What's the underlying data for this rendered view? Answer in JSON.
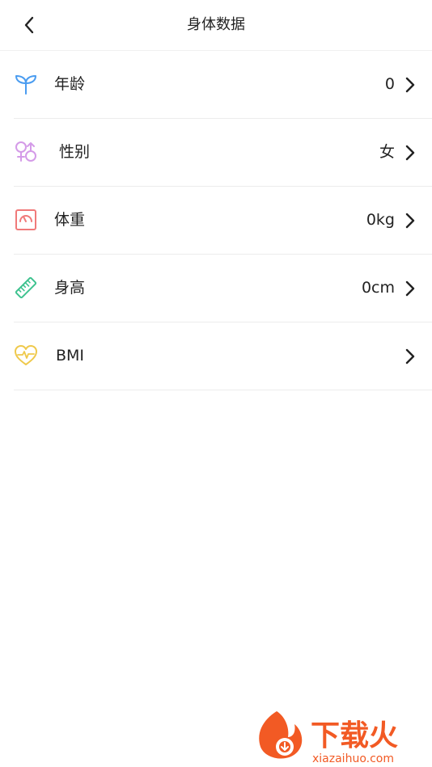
{
  "header": {
    "title": "身体数据"
  },
  "rows": [
    {
      "label": "年龄",
      "value": "0",
      "icon": "sprout-icon"
    },
    {
      "label": "性别",
      "value": "女",
      "icon": "gender-icon"
    },
    {
      "label": "体重",
      "value": "0kg",
      "icon": "scale-icon"
    },
    {
      "label": "身高",
      "value": "0cm",
      "icon": "ruler-icon"
    },
    {
      "label": "BMI",
      "value": "",
      "icon": "heart-pulse-icon"
    }
  ],
  "colors": {
    "age": "#4a9cf0",
    "gender": "#d49be8",
    "weight": "#f07a7a",
    "height": "#3ec28f",
    "bmi": "#efc94c",
    "watermark": "#f25a24"
  },
  "watermark": {
    "brand": "下载火",
    "site": "xiazaihuo.com"
  }
}
